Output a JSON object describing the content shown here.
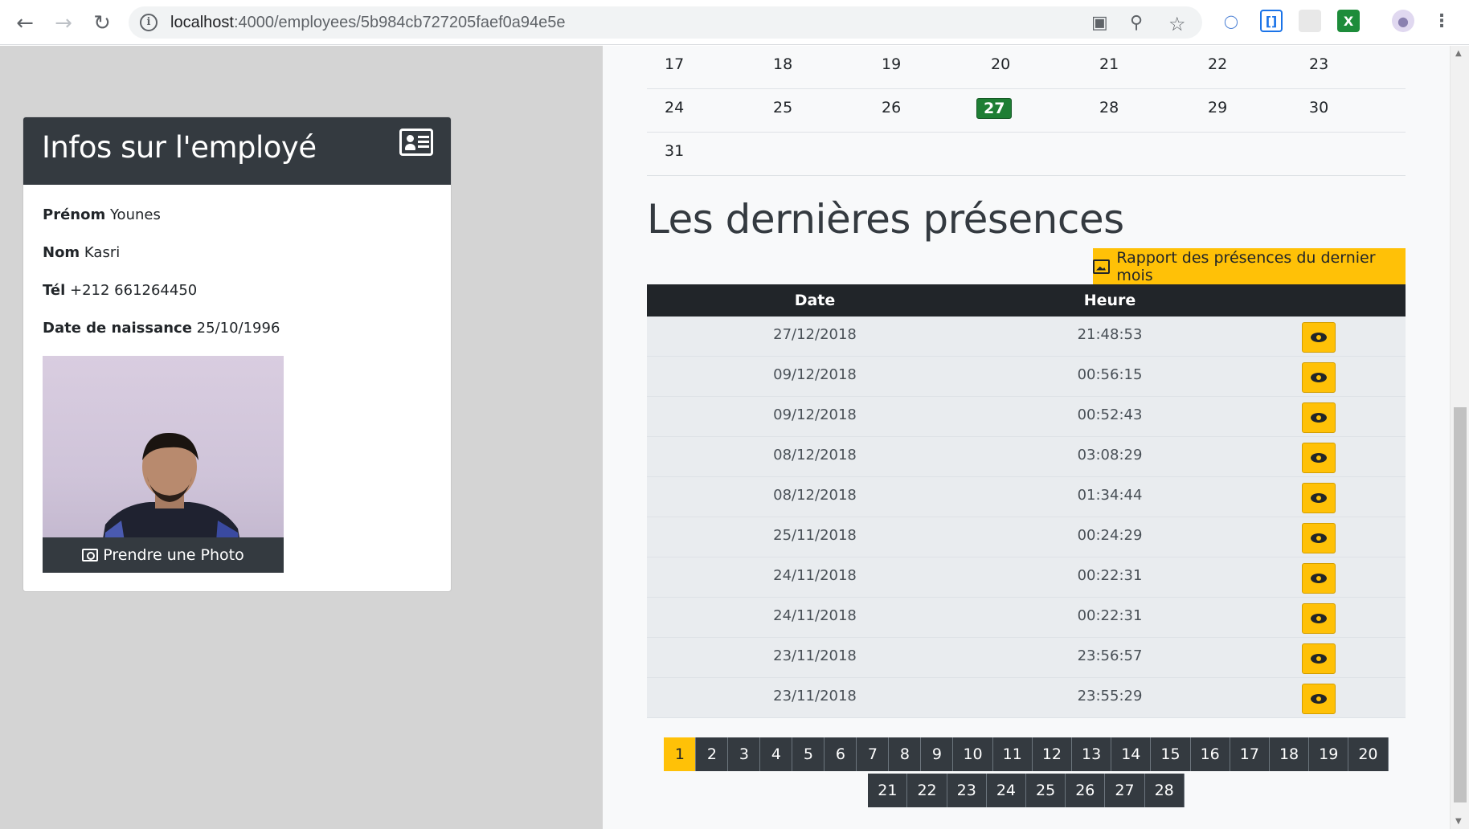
{
  "browser": {
    "url_host": "localhost",
    "url_rest": ":4000/employees/5b984cb727205faef0a94e5e"
  },
  "employee_card": {
    "title": "Infos sur l'employé",
    "fields": [
      {
        "label": "Prénom",
        "value": "Younes"
      },
      {
        "label": "Nom",
        "value": "Kasri"
      },
      {
        "label": "Tél",
        "value": "+212 661264450"
      },
      {
        "label": "Date de naissance",
        "value": "25/10/1996"
      }
    ],
    "photo_button": "Prendre une Photo"
  },
  "calendar": {
    "rows": [
      [
        "17",
        "18",
        "19",
        "20",
        "21",
        "22",
        "23"
      ],
      [
        "24",
        "25",
        "26",
        "27",
        "28",
        "29",
        "30"
      ],
      [
        "31"
      ]
    ],
    "today": "27"
  },
  "presences": {
    "title": "Les dernières présences",
    "report_button": "Rapport des présences du dernier mois",
    "columns": [
      "Date",
      "Heure"
    ],
    "rows": [
      {
        "date": "27/12/2018",
        "time": "21:48:53"
      },
      {
        "date": "09/12/2018",
        "time": "00:56:15"
      },
      {
        "date": "09/12/2018",
        "time": "00:52:43"
      },
      {
        "date": "08/12/2018",
        "time": "03:08:29"
      },
      {
        "date": "08/12/2018",
        "time": "01:34:44"
      },
      {
        "date": "25/11/2018",
        "time": "00:24:29"
      },
      {
        "date": "24/11/2018",
        "time": "00:22:31"
      },
      {
        "date": "24/11/2018",
        "time": "00:22:31"
      },
      {
        "date": "23/11/2018",
        "time": "23:56:57"
      },
      {
        "date": "23/11/2018",
        "time": "23:55:29"
      }
    ]
  },
  "pagination": {
    "active": "1",
    "lines": [
      [
        "1",
        "2",
        "3",
        "4",
        "5",
        "6",
        "7",
        "8",
        "9",
        "10",
        "11",
        "12",
        "13",
        "14",
        "15",
        "16",
        "17",
        "18",
        "19",
        "20"
      ],
      [
        "21",
        "22",
        "23",
        "24",
        "25",
        "26",
        "27",
        "28"
      ]
    ]
  }
}
